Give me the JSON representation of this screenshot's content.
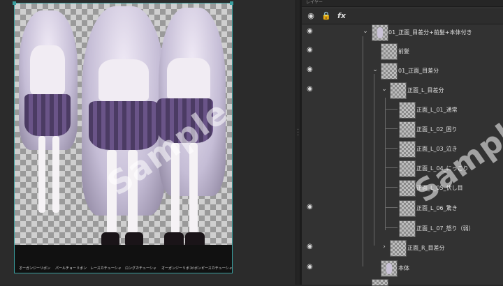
{
  "canvas": {
    "strip_labels": [
      "オーガンジーリボン",
      "パールチョーリボン",
      "レースカチューシャ",
      "ロングカチューシャ",
      "オーガンジーリボン",
      "リボンピースカチューシャ"
    ],
    "watermark": "Sample",
    "accent_color": "#3aa0a0"
  },
  "panel": {
    "header_title": "レイヤー",
    "toolbar": {
      "visibility_icon": "eye-icon",
      "lock_icon": "lock-icon",
      "fx_label": "fx"
    },
    "watermark": "Sample",
    "layers": [
      {
        "name": "01_正面_目差分+前髪+本体付き",
        "visible": true,
        "expanded": true
      },
      {
        "name": "前髪",
        "visible": true
      },
      {
        "name": "01_正面_目差分",
        "visible": true,
        "expanded": true
      },
      {
        "name": "正面_L_目差分",
        "visible": true,
        "expanded": true
      },
      {
        "name": "正面_L_01_通常",
        "visible": false
      },
      {
        "name": "正面_L_02_困り",
        "visible": false
      },
      {
        "name": "正面_L_03_泣き",
        "visible": false
      },
      {
        "name": "正面_L_04_にっこり",
        "visible": false
      },
      {
        "name": "正面_L_05_伏し目",
        "visible": false
      },
      {
        "name": "正面_L_06_驚き",
        "visible": true
      },
      {
        "name": "正面_L_07_怒り（弱）",
        "visible": false
      },
      {
        "name": "正面_R_目差分",
        "visible": true,
        "expanded": false
      },
      {
        "name": "本体",
        "visible": true
      }
    ]
  }
}
